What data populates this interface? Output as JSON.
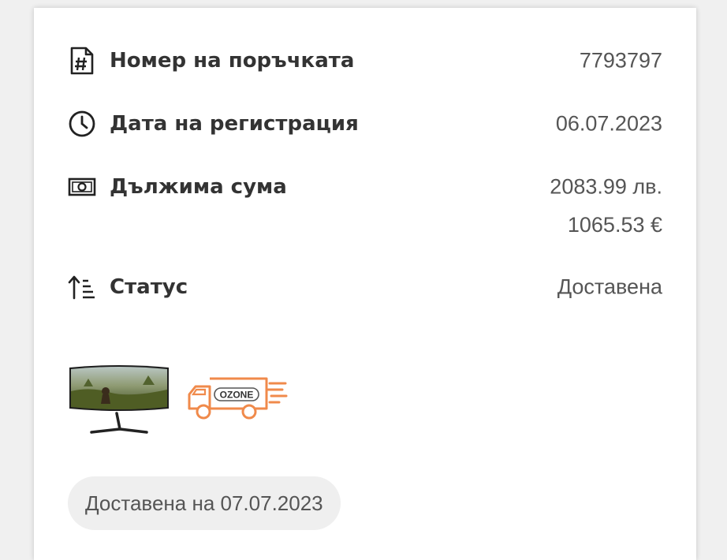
{
  "order": {
    "number_label": "Номер на поръчката",
    "number_value": "7793797",
    "date_label": "Дата на регистрация",
    "date_value": "06.07.2023",
    "amount_label": "Дължима сума",
    "amount_bgn": "2083.99 лв.",
    "amount_eur": "1065.53 €",
    "status_label": "Статус",
    "status_value": "Доставена"
  },
  "items": [
    {
      "icon": "monitor-thumbnail"
    },
    {
      "icon": "ozone-delivery-truck",
      "logo_text": "OZONE"
    }
  ],
  "delivery": {
    "badge_text": "Доставена на 07.07.2023"
  },
  "colors": {
    "text_primary": "#333333",
    "text_secondary": "#555555",
    "truck_orange": "#f08a4b",
    "pill_bg": "#efefef"
  }
}
